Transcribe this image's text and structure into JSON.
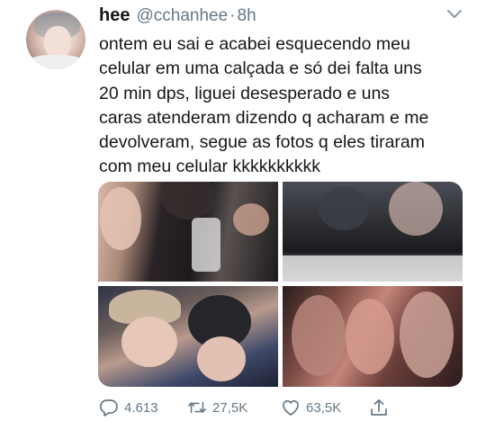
{
  "tweet": {
    "author_name": "hee",
    "author_handle": "@cchanhee",
    "separator": "·",
    "time_ago": "8h",
    "text_lines": [
      "ontem eu sai e acabei esquecendo meu",
      "celular em uma calçada e só dei falta uns",
      "20 min dps, liguei desesperado e uns",
      "caras atenderam dizendo q acharam e me",
      "devolveram, segue as fotos q eles tiraram",
      "com meu celular kkkkkkkkkk"
    ],
    "media_count": 4
  },
  "actions": {
    "reply_count": "4.613",
    "retweet_count": "27,5K",
    "like_count": "63,5K"
  },
  "icons": {
    "reply": "speech-bubble-icon",
    "retweet": "retweet-arrows-icon",
    "like": "heart-outline-icon",
    "share": "share-upload-icon",
    "menu": "chevron-down-icon"
  },
  "colors": {
    "text": "#14171a",
    "secondary": "#657786"
  }
}
